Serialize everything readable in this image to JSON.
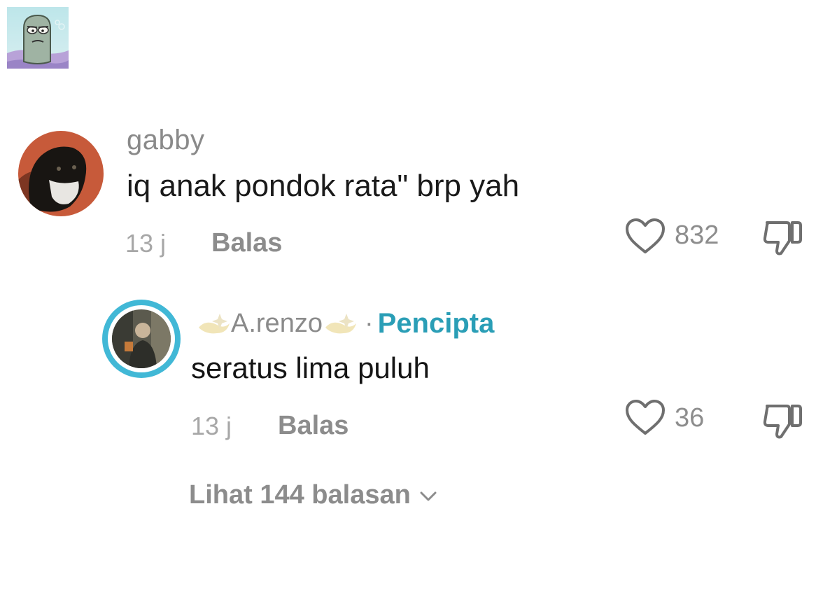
{
  "sticker": {
    "icon": "fish-character-sticker"
  },
  "comments": [
    {
      "username": "gabby",
      "text": "iq anak pondok rata\" brp yah",
      "time": "13 j",
      "reply_label": "Balas",
      "likes": "832",
      "avatar_icon": "cat-avatar"
    }
  ],
  "reply": {
    "username": "A.renzo",
    "separator": "·",
    "badge": "Pencipta",
    "text": "seratus lima puluh",
    "time": "13 j",
    "reply_label": "Balas",
    "likes": "36",
    "avatar_icon": "person-avatar",
    "ring_color": "#41b8d6",
    "badge_color": "#2a9eb6"
  },
  "view_replies": {
    "label": "Lihat 144 balasan"
  }
}
